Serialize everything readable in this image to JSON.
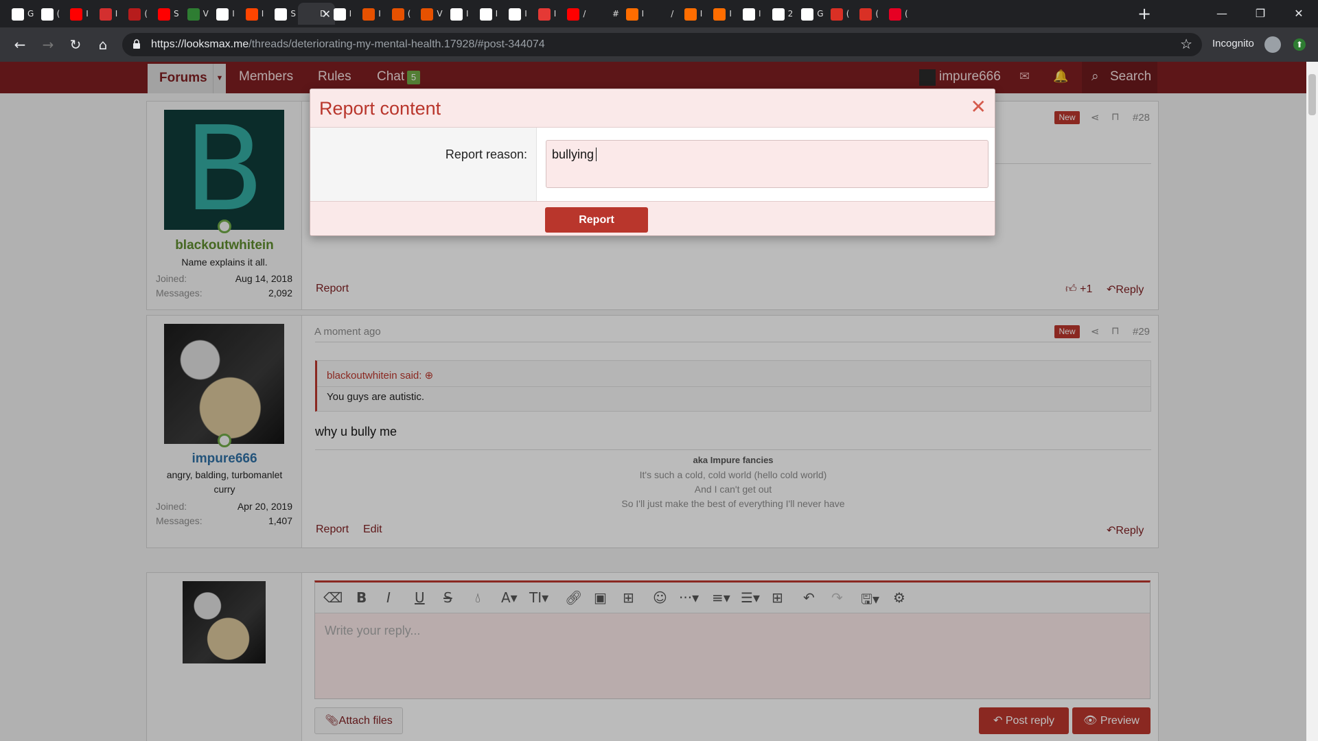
{
  "browser": {
    "tabs": [
      {
        "title": "G",
        "favicon_color": "#ffffff"
      },
      {
        "title": "(",
        "favicon_color": "#ffffff"
      },
      {
        "title": "I",
        "favicon_color": "#ff0000"
      },
      {
        "title": "I",
        "favicon_color": "#d32f2f"
      },
      {
        "title": "(",
        "favicon_color": "#b71c1c"
      },
      {
        "title": "S",
        "favicon_color": "#ff0000"
      },
      {
        "title": "V",
        "favicon_color": "#2e7d32"
      },
      {
        "title": "I",
        "favicon_color": "#ffffff"
      },
      {
        "title": "I",
        "favicon_color": "#ff4500"
      },
      {
        "title": "S",
        "favicon_color": "#ffffff"
      },
      {
        "title": "D",
        "favicon_color": "#35363a",
        "active": true
      },
      {
        "title": "I",
        "favicon_color": "#ffffff"
      },
      {
        "title": "I",
        "favicon_color": "#e65100"
      },
      {
        "title": "(",
        "favicon_color": "#e65100"
      },
      {
        "title": "V",
        "favicon_color": "#e65100"
      },
      {
        "title": "I",
        "favicon_color": "#ffffff"
      },
      {
        "title": "I",
        "favicon_color": "#ffffff"
      },
      {
        "title": "I",
        "favicon_color": "#ffffff"
      },
      {
        "title": "I",
        "favicon_color": "#e53935"
      },
      {
        "title": "/",
        "favicon_color": "#ff0000"
      },
      {
        "title": "#",
        "favicon_color": "#202124"
      },
      {
        "title": "I",
        "favicon_color": "#ff6d00"
      },
      {
        "title": "/",
        "favicon_color": "#202124"
      },
      {
        "title": "I",
        "favicon_color": "#ff6d00"
      },
      {
        "title": "I",
        "favicon_color": "#ff6d00"
      },
      {
        "title": "I",
        "favicon_color": "#ffffff"
      },
      {
        "title": "2",
        "favicon_color": "#ffffff"
      },
      {
        "title": "G",
        "favicon_color": "#ffffff"
      },
      {
        "title": "(",
        "favicon_color": "#d93025"
      },
      {
        "title": "(",
        "favicon_color": "#d93025"
      },
      {
        "title": "(",
        "favicon_color": "#e60023"
      }
    ],
    "url_host": "https://looksmax.me",
    "url_path": "/threads/deteriorating-my-mental-health.17928/#post-344074",
    "incognito_label": "Incognito"
  },
  "nav": {
    "forums": "Forums",
    "members": "Members",
    "rules": "Rules",
    "chat": "Chat",
    "chat_count": "5",
    "username": "impure666",
    "search": "Search"
  },
  "modal": {
    "title": "Report content",
    "reason_label": "Report reason:",
    "reason_value": "bullying",
    "submit": "Report"
  },
  "post1": {
    "avatar_letter": "B",
    "username": "blackoutwhitein",
    "user_title": "Name explains it all.",
    "joined_label": "Joined:",
    "joined": "Aug 14, 2018",
    "messages_label": "Messages:",
    "messages": "2,092",
    "new_badge": "New",
    "post_number": "#28",
    "report": "Report",
    "like_count": "+1",
    "reply": "Reply"
  },
  "post2": {
    "username": "impure666",
    "user_title": "angry, balding, turbomanlet curry",
    "joined_label": "Joined:",
    "joined": "Apr 20, 2019",
    "messages_label": "Messages:",
    "messages": "1,407",
    "time": "A moment ago",
    "new_badge": "New",
    "post_number": "#29",
    "quote_author": "blackoutwhitein said:",
    "quote_text": "You guys are autistic.",
    "body": "why u bully me",
    "signature": [
      "aka Impure fancies",
      "It's such a cold, cold world (hello cold world)",
      "And I can't get out",
      "So I'll just make the best of everything I'll never have"
    ],
    "report": "Report",
    "edit": "Edit",
    "reply": "Reply"
  },
  "editor": {
    "placeholder": "Write your reply...",
    "attach": "Attach files",
    "post_reply": "Post reply",
    "preview": "Preview"
  },
  "colors": {
    "brand": "#7d1e20",
    "accent": "#b9362c",
    "online": "#6fa847"
  }
}
